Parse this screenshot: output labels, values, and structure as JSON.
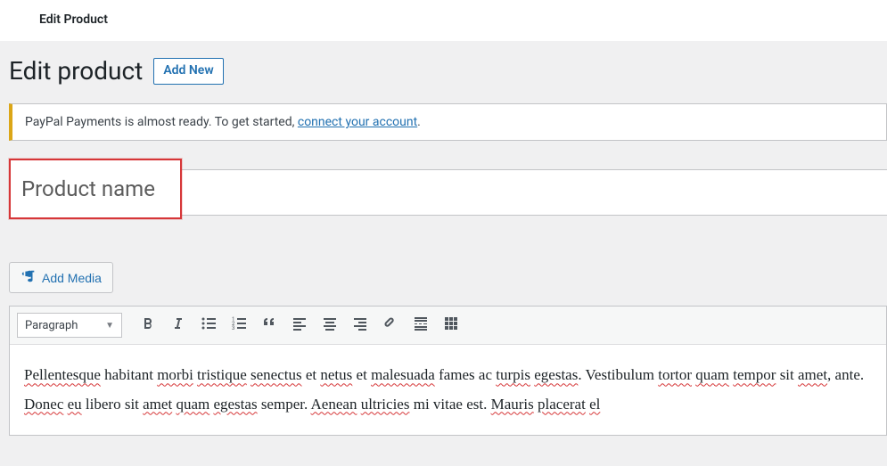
{
  "topbar": {
    "title": "Edit Product"
  },
  "header": {
    "page_title": "Edit product",
    "add_new_label": "Add New"
  },
  "notice": {
    "prefix": "PayPal Payments is almost ready. To get started, ",
    "link_text": "connect your account",
    "suffix": "."
  },
  "title_field": {
    "placeholder": "Product name",
    "value": ""
  },
  "media_button": {
    "label": "Add Media"
  },
  "toolbar": {
    "format_label": "Paragraph",
    "buttons": [
      {
        "name": "bold-icon"
      },
      {
        "name": "italic-icon"
      },
      {
        "name": "bullet-list-icon"
      },
      {
        "name": "numbered-list-icon"
      },
      {
        "name": "blockquote-icon"
      },
      {
        "name": "align-left-icon"
      },
      {
        "name": "align-center-icon"
      },
      {
        "name": "align-right-icon"
      },
      {
        "name": "link-icon"
      },
      {
        "name": "read-more-icon"
      },
      {
        "name": "toolbar-toggle-icon"
      }
    ]
  },
  "content": {
    "segments": [
      {
        "t": "Pellentesque",
        "w": true
      },
      {
        "t": " habitant ",
        "w": false
      },
      {
        "t": "morbi",
        "w": true
      },
      {
        "t": " ",
        "w": false
      },
      {
        "t": "tristique",
        "w": true
      },
      {
        "t": " ",
        "w": false
      },
      {
        "t": "senectus",
        "w": true
      },
      {
        "t": " et ",
        "w": false
      },
      {
        "t": "netus",
        "w": true
      },
      {
        "t": " et ",
        "w": false
      },
      {
        "t": "malesuada",
        "w": true
      },
      {
        "t": " fames ac ",
        "w": false
      },
      {
        "t": "turpis",
        "w": true
      },
      {
        "t": " ",
        "w": false
      },
      {
        "t": "egestas",
        "w": true
      },
      {
        "t": ". Vestibulum ",
        "w": false
      },
      {
        "t": "tortor",
        "w": true
      },
      {
        "t": " ",
        "w": false
      },
      {
        "t": "quam",
        "w": true
      },
      {
        "t": " ",
        "w": false
      },
      {
        "t": "tempor",
        "w": true
      },
      {
        "t": " sit ",
        "w": false
      },
      {
        "t": "amet",
        "w": true
      },
      {
        "t": ", ante. ",
        "w": false
      },
      {
        "t": "Donec",
        "w": true
      },
      {
        "t": " ",
        "w": false
      },
      {
        "t": "eu",
        "w": true
      },
      {
        "t": " libero sit ",
        "w": false
      },
      {
        "t": "amet",
        "w": true
      },
      {
        "t": " ",
        "w": false
      },
      {
        "t": "quam",
        "w": true
      },
      {
        "t": " ",
        "w": false
      },
      {
        "t": "egestas",
        "w": true
      },
      {
        "t": " semper. ",
        "w": false
      },
      {
        "t": "Aenean",
        "w": true
      },
      {
        "t": " ",
        "w": false
      },
      {
        "t": "ultricies",
        "w": true
      },
      {
        "t": " mi vitae est. ",
        "w": false
      },
      {
        "t": "Mauris",
        "w": true
      },
      {
        "t": " ",
        "w": false
      },
      {
        "t": "placerat",
        "w": true
      },
      {
        "t": " ",
        "w": false
      },
      {
        "t": "el",
        "w": true
      }
    ]
  }
}
